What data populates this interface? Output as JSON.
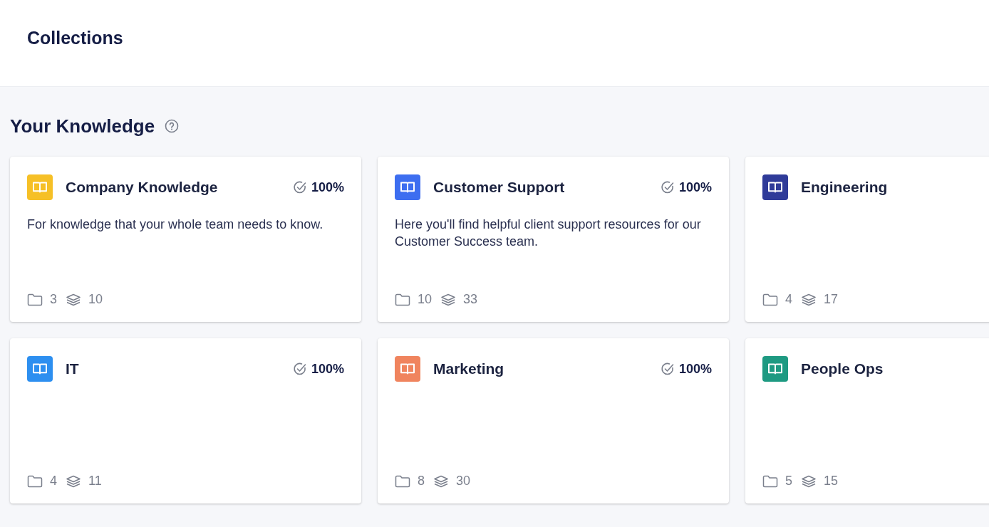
{
  "page_title": "Collections",
  "section": {
    "title": "Your Knowledge"
  },
  "collections": [
    {
      "name": "Company Knowledge",
      "color": "#f6c026",
      "verified": "100%",
      "description": "For knowledge that your whole team needs to know.",
      "folders": "3",
      "cards": "10"
    },
    {
      "name": "Customer Support",
      "color": "#3d6ef0",
      "verified": "100%",
      "description": "Here you'll find helpful client support resources for our Customer Success team.",
      "folders": "10",
      "cards": "33"
    },
    {
      "name": "Engineering",
      "color": "#2f3b99",
      "folders": "4",
      "cards": "17"
    },
    {
      "name": "IT",
      "color": "#2d8ff0",
      "verified": "100%",
      "folders": "4",
      "cards": "11"
    },
    {
      "name": "Marketing",
      "color": "#f0845e",
      "verified": "100%",
      "folders": "8",
      "cards": "30"
    },
    {
      "name": "People Ops",
      "color": "#1e9a82",
      "folders": "5",
      "cards": "15"
    }
  ]
}
